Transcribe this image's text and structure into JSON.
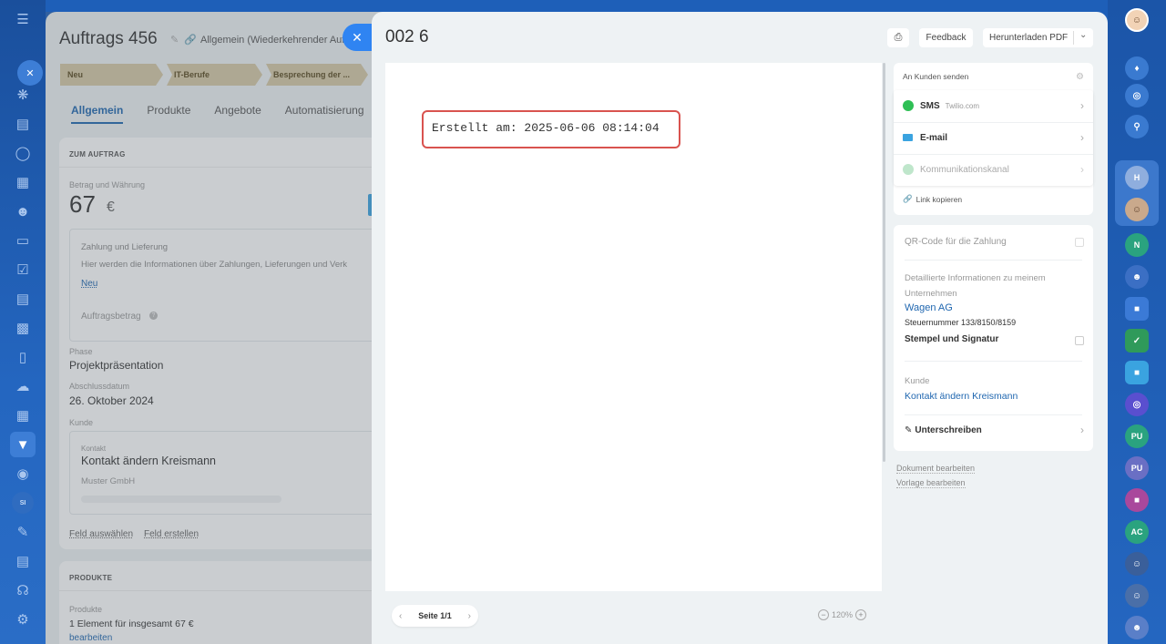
{
  "deal": {
    "title": "Auftrags 456",
    "subtitle": "Allgemein (Wiederkehrender Auftr",
    "stages": [
      "Neu",
      "IT-Berufe",
      "Besprechung der ..."
    ],
    "tabs": [
      "Allgemein",
      "Produkte",
      "Angebote",
      "Automatisierung"
    ],
    "section_order": "ZUM AUFTRAG",
    "amount_label": "Betrag und Währung",
    "amount_value": "67",
    "amount_currency": "€",
    "payment_title": "Zahlung und Lieferung",
    "payment_text": "Hier werden die Informationen über Zahlungen, Lieferungen und Verk",
    "payment_new": "Neu",
    "order_amount_label": "Auftragsbetrag",
    "phase_label": "Phase",
    "phase_value": "Projektpräsentation",
    "close_label": "Abschlussdatum",
    "close_value": "26. Oktober 2024",
    "client_label": "Kunde",
    "contact_label": "Kontakt",
    "contact_name": "Kontakt ändern Kreismann",
    "contact_company": "Muster GmbH",
    "field_select": "Feld auswählen",
    "field_create": "Feld erstellen",
    "section_products": "PRODUKTE",
    "products_label": "Produkte",
    "products_value": "1 Element für insgesamt 67 €",
    "products_edit": "bearbeiten"
  },
  "document": {
    "title": "002 6",
    "feedback": "Feedback",
    "download": "Herunterladen PDF",
    "stamp": "Erstellt am: 2025-06-06 08:14:04",
    "page": "Seite 1/1",
    "zoom": "120%"
  },
  "send": {
    "header": "An Kunden senden",
    "sms": "SMS",
    "sms_provider": "Twilio.com",
    "email": "E-mail",
    "channel": "Kommunikationskanal",
    "copy_link": "Link kopieren"
  },
  "settings": {
    "qr": "QR-Code für die Zahlung",
    "details_label": "Detaillierte Informationen zu meinem Unternehmen",
    "company": "Wagen AG",
    "tax": "Steuernummer 133/8150/8159",
    "stamp_sig": "Stempel und Signatur",
    "client_label": "Kunde",
    "client_value": "Kontakt ändern Kreismann",
    "sign": "Unterschreiben"
  },
  "links": {
    "edit_doc": "Dokument bearbeiten",
    "edit_tpl": "Vorlage bearbeiten"
  },
  "rail": {
    "avatars": [
      "H",
      "N",
      "PU",
      "PU",
      "AC"
    ],
    "si": "SI"
  },
  "colors": {
    "accent": "#2067b0",
    "highlight_border": "#d9534f",
    "close_button": "#2f84f2",
    "whatsapp": "#2fbf55"
  }
}
